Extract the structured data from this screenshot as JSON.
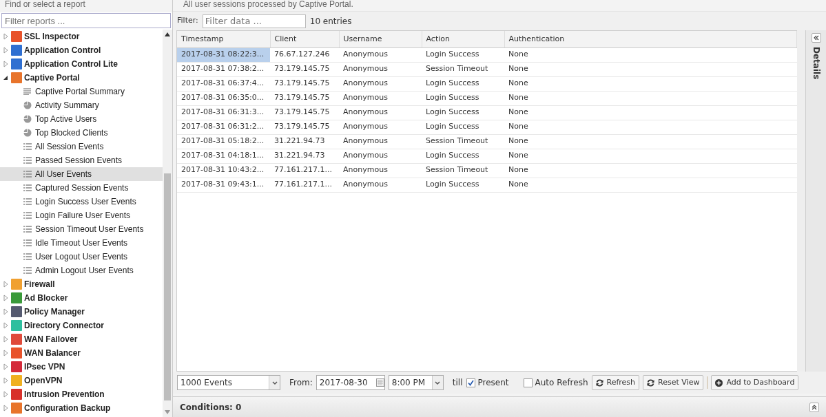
{
  "sidebar": {
    "title": "Find or select a report",
    "filter_placeholder": "Filter reports ...",
    "tree": [
      {
        "label": "SSL Inspector",
        "kind": "app",
        "color": "#e8532b",
        "expanded": false,
        "selected": false
      },
      {
        "label": "Application Control",
        "kind": "app",
        "color": "#2f6fd1",
        "expanded": false,
        "selected": false
      },
      {
        "label": "Application Control Lite",
        "kind": "app",
        "color": "#2f6fd1",
        "expanded": false,
        "selected": false
      },
      {
        "label": "Captive Portal",
        "kind": "app",
        "color": "#e8742b",
        "expanded": true,
        "selected": false,
        "children": [
          {
            "label": "Captive Portal Summary",
            "kind": "summary",
            "selected": false
          },
          {
            "label": "Activity Summary",
            "kind": "pie",
            "selected": false
          },
          {
            "label": "Top Active Users",
            "kind": "pie",
            "selected": false
          },
          {
            "label": "Top Blocked Clients",
            "kind": "pie",
            "selected": false
          },
          {
            "label": "All Session Events",
            "kind": "list",
            "selected": false
          },
          {
            "label": "Passed Session Events",
            "kind": "list",
            "selected": false
          },
          {
            "label": "All User Events",
            "kind": "list",
            "selected": true
          },
          {
            "label": "Captured Session Events",
            "kind": "list",
            "selected": false
          },
          {
            "label": "Login Success User Events",
            "kind": "list",
            "selected": false
          },
          {
            "label": "Login Failure User Events",
            "kind": "list",
            "selected": false
          },
          {
            "label": "Session Timeout User Events",
            "kind": "list",
            "selected": false
          },
          {
            "label": "Idle Timeout User Events",
            "kind": "list",
            "selected": false
          },
          {
            "label": "User Logout User Events",
            "kind": "list",
            "selected": false
          },
          {
            "label": "Admin Logout User Events",
            "kind": "list",
            "selected": false
          }
        ]
      },
      {
        "label": "Firewall",
        "kind": "app",
        "color": "#f0a030",
        "expanded": false,
        "selected": false
      },
      {
        "label": "Ad Blocker",
        "kind": "app",
        "color": "#3a9a3a",
        "expanded": false,
        "selected": false
      },
      {
        "label": "Policy Manager",
        "kind": "app",
        "color": "#555a70",
        "expanded": false,
        "selected": false
      },
      {
        "label": "Directory Connector",
        "kind": "app",
        "color": "#2fbf9f",
        "expanded": false,
        "selected": false
      },
      {
        "label": "WAN Failover",
        "kind": "app",
        "color": "#e04a3a",
        "expanded": false,
        "selected": false
      },
      {
        "label": "WAN Balancer",
        "kind": "app",
        "color": "#e8532b",
        "expanded": false,
        "selected": false
      },
      {
        "label": "IPsec VPN",
        "kind": "app",
        "color": "#d42a3a",
        "expanded": false,
        "selected": false
      },
      {
        "label": "OpenVPN",
        "kind": "app",
        "color": "#f0b020",
        "expanded": false,
        "selected": false
      },
      {
        "label": "Intrusion Prevention",
        "kind": "app",
        "color": "#d8302a",
        "expanded": false,
        "selected": false
      },
      {
        "label": "Configuration Backup",
        "kind": "app",
        "color": "#e8742b",
        "expanded": false,
        "selected": false
      }
    ]
  },
  "description": "All user sessions processed by Captive Portal.",
  "filter": {
    "label": "Filter:",
    "placeholder": "Filter data ...",
    "count": "10 entries"
  },
  "table": {
    "columns": [
      "Timestamp",
      "Client",
      "Username",
      "Action",
      "Authentication"
    ],
    "rows": [
      {
        "cells": [
          "2017-08-31 08:22:3...",
          "76.67.127.246",
          "Anonymous",
          "Login Success",
          "None"
        ],
        "selected": true
      },
      {
        "cells": [
          "2017-08-31 07:38:2...",
          "73.179.145.75",
          "Anonymous",
          "Session Timeout",
          "None"
        ],
        "selected": false
      },
      {
        "cells": [
          "2017-08-31 06:37:4...",
          "73.179.145.75",
          "Anonymous",
          "Login Success",
          "None"
        ],
        "selected": false
      },
      {
        "cells": [
          "2017-08-31 06:35:0...",
          "73.179.145.75",
          "Anonymous",
          "Login Success",
          "None"
        ],
        "selected": false
      },
      {
        "cells": [
          "2017-08-31 06:31:3...",
          "73.179.145.75",
          "Anonymous",
          "Login Success",
          "None"
        ],
        "selected": false
      },
      {
        "cells": [
          "2017-08-31 06:31:2...",
          "73.179.145.75",
          "Anonymous",
          "Login Success",
          "None"
        ],
        "selected": false
      },
      {
        "cells": [
          "2017-08-31 05:18:2...",
          "31.221.94.73",
          "Anonymous",
          "Session Timeout",
          "None"
        ],
        "selected": false
      },
      {
        "cells": [
          "2017-08-31 04:18:1...",
          "31.221.94.73",
          "Anonymous",
          "Login Success",
          "None"
        ],
        "selected": false
      },
      {
        "cells": [
          "2017-08-31 10:43:2...",
          "77.161.217.1...",
          "Anonymous",
          "Session Timeout",
          "None"
        ],
        "selected": false
      },
      {
        "cells": [
          "2017-08-31 09:43:1...",
          "77.161.217.1...",
          "Anonymous",
          "Login Success",
          "None"
        ],
        "selected": false
      }
    ]
  },
  "details_label": "Details",
  "toolbar": {
    "limit": "1000 Events",
    "from_label": "From:",
    "from_date": "2017-08-30",
    "from_time": "8:00 PM",
    "till_label": "till",
    "present": {
      "label": "Present",
      "checked": true
    },
    "auto_refresh": {
      "label": "Auto Refresh",
      "checked": false
    },
    "buttons": [
      {
        "label": "Refresh",
        "kind": "refresh"
      },
      {
        "label": "Reset View",
        "kind": "refresh"
      },
      {
        "label": "Add to Dashboard",
        "kind": "add"
      }
    ]
  },
  "conditions": "Conditions: 0"
}
